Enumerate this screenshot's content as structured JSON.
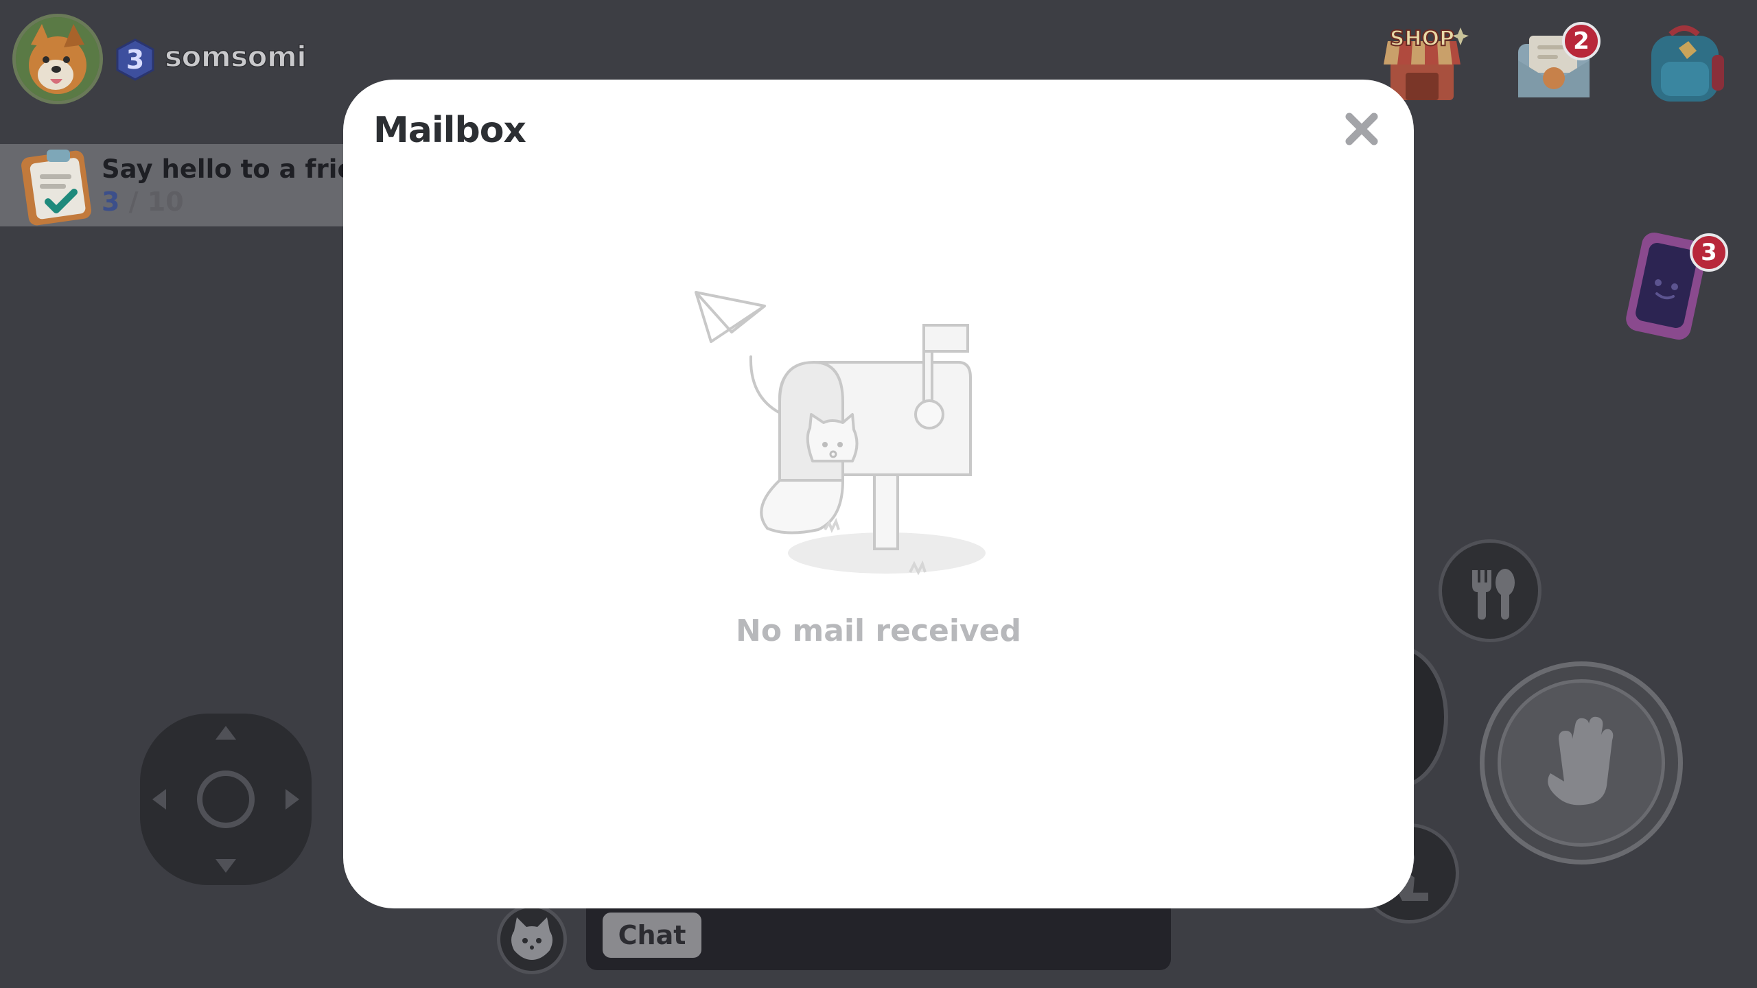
{
  "player": {
    "level": "3",
    "name": "somsomi"
  },
  "quest": {
    "title": "Say hello to a friend",
    "current": "3",
    "separator": " / ",
    "total": "10"
  },
  "hud": {
    "shop_label": "SHOP",
    "mail_badge": "2",
    "phone_badge": "3"
  },
  "chat": {
    "button_label": "Chat"
  },
  "mailbox": {
    "title": "Mailbox",
    "empty_message": "No mail received"
  },
  "icons": {
    "avatar": "dog-avatar-icon",
    "level": "hexagon-level-icon",
    "quest": "clipboard-check-icon",
    "shop": "shop-stall-icon",
    "mail": "envelope-icon",
    "backpack": "backpack-icon",
    "phone": "phone-icon",
    "joystick": "dpad-joystick-icon",
    "eat": "fork-spoon-icon",
    "wave": "hand-wave-icon",
    "emote": "cat-face-icon",
    "close": "close-icon",
    "empty": "empty-mailbox-illustration"
  },
  "colors": {
    "overlay_bg": "#3d3e44",
    "modal_bg": "#ffffff",
    "badge_red": "#b8273a",
    "muted_text": "#b7b8bb"
  }
}
